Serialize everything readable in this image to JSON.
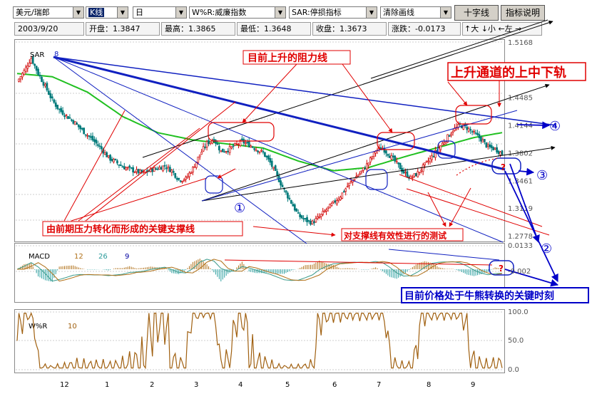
{
  "toolbar": {
    "pair": "美元/瑞郎",
    "mode_selected": "K线",
    "period": "日",
    "indicator_wr": "W%R:威廉指数",
    "indicator_sar": "SAR:停损指标",
    "clear_lines": "清除画线",
    "crosshair_label": "十字线",
    "indicator_help_label": "指标说明",
    "zoom_in_label": "↑大",
    "zoom_out_label": "↓小",
    "pan_left_label": "←左",
    "pan_right_label": "→"
  },
  "info_bar": {
    "date": "2003/9/20",
    "open_label": "开盘：",
    "open": "1.3847",
    "high_label": "最高：",
    "high": "1.3865",
    "low_label": "最低：",
    "low": "1.3648",
    "close_label": "收盘：",
    "close": "1.3673",
    "change_label": "涨跌：",
    "change": "-0.0173"
  },
  "chart_data": [
    {
      "type": "candlestick",
      "title": "SAR",
      "title_mark": "8",
      "y_ticks": [
        "1.5168",
        "1.4485",
        "1.4144",
        "1.3802",
        "1.3461",
        "1.3119",
        "1.2778"
      ],
      "ylim": [
        1.2778,
        1.5168
      ],
      "x_ticks": [
        "12",
        "1",
        "2",
        "3",
        "4",
        "5",
        "6",
        "7",
        "8",
        "9"
      ],
      "close_path": [
        [
          0,
          1.468
        ],
        [
          4,
          1.481
        ],
        [
          8,
          1.497
        ],
        [
          12,
          1.478
        ],
        [
          16,
          1.462
        ],
        [
          20,
          1.445
        ],
        [
          24,
          1.433
        ],
        [
          28,
          1.426
        ],
        [
          32,
          1.419
        ],
        [
          36,
          1.41
        ],
        [
          40,
          1.402
        ],
        [
          44,
          1.394
        ],
        [
          48,
          1.385
        ],
        [
          52,
          1.374
        ],
        [
          56,
          1.369
        ],
        [
          60,
          1.363
        ],
        [
          64,
          1.36
        ],
        [
          68,
          1.357
        ],
        [
          72,
          1.355
        ],
        [
          76,
          1.359
        ],
        [
          80,
          1.361
        ],
        [
          84,
          1.364
        ],
        [
          88,
          1.358
        ],
        [
          92,
          1.347
        ],
        [
          96,
          1.348
        ],
        [
          100,
          1.361
        ],
        [
          104,
          1.378
        ],
        [
          108,
          1.392
        ],
        [
          112,
          1.397
        ],
        [
          116,
          1.382
        ],
        [
          120,
          1.384
        ],
        [
          124,
          1.389
        ],
        [
          128,
          1.394
        ],
        [
          132,
          1.39
        ],
        [
          136,
          1.385
        ],
        [
          140,
          1.38
        ],
        [
          144,
          1.368
        ],
        [
          148,
          1.351
        ],
        [
          152,
          1.334
        ],
        [
          156,
          1.319
        ],
        [
          160,
          1.303
        ],
        [
          164,
          1.297
        ],
        [
          168,
          1.294
        ],
        [
          172,
          1.301
        ],
        [
          176,
          1.31
        ],
        [
          180,
          1.318
        ],
        [
          184,
          1.327
        ],
        [
          188,
          1.339
        ],
        [
          192,
          1.349
        ],
        [
          196,
          1.357
        ],
        [
          200,
          1.368
        ],
        [
          204,
          1.383
        ],
        [
          208,
          1.386
        ],
        [
          212,
          1.377
        ],
        [
          216,
          1.367
        ],
        [
          220,
          1.356
        ],
        [
          224,
          1.349
        ],
        [
          228,
          1.355
        ],
        [
          232,
          1.365
        ],
        [
          236,
          1.375
        ],
        [
          240,
          1.386
        ],
        [
          244,
          1.397
        ],
        [
          248,
          1.408
        ],
        [
          252,
          1.414
        ],
        [
          256,
          1.411
        ],
        [
          260,
          1.404
        ],
        [
          264,
          1.397
        ],
        [
          268,
          1.387
        ],
        [
          272,
          1.385
        ],
        [
          276,
          1.379
        ]
      ],
      "ma_path": [
        [
          0,
          1.478
        ],
        [
          20,
          1.474
        ],
        [
          40,
          1.455
        ],
        [
          60,
          1.425
        ],
        [
          80,
          1.405
        ],
        [
          100,
          1.396
        ],
        [
          120,
          1.391
        ],
        [
          140,
          1.386
        ],
        [
          160,
          1.37
        ],
        [
          180,
          1.358
        ],
        [
          200,
          1.362
        ],
        [
          220,
          1.375
        ],
        [
          240,
          1.387
        ],
        [
          260,
          1.399
        ],
        [
          276,
          1.405
        ]
      ],
      "annotations": {
        "resistance_label": "目前上升的阻力线",
        "channel_label": "上升通道的上中下轨",
        "support_label": "由前期压力转化而形成的关键支撑线",
        "test_label": "对支撑线有效性进行的测试",
        "key_moment_label": "目前价格处于牛熊转换的关键时刻",
        "circle_1": "①",
        "circle_2": "②",
        "circle_3": "③",
        "circle_4": "④",
        "question_mark": "?"
      }
    },
    {
      "type": "line",
      "title": "MACD",
      "params": [
        "12",
        "26",
        "9"
      ],
      "y_ticks": [
        "0.0133",
        "-0.002"
      ],
      "colors": {
        "line1": "#3a9a8a",
        "line2": "#b07018",
        "hist_up": "#b07018",
        "hist_down": "#2aa0a0"
      }
    },
    {
      "type": "line",
      "title": "W%R",
      "param": "10",
      "y_ticks": [
        "100.0",
        "50.0",
        "0.0"
      ],
      "ylim": [
        0,
        100
      ],
      "color": "#a06010"
    }
  ]
}
